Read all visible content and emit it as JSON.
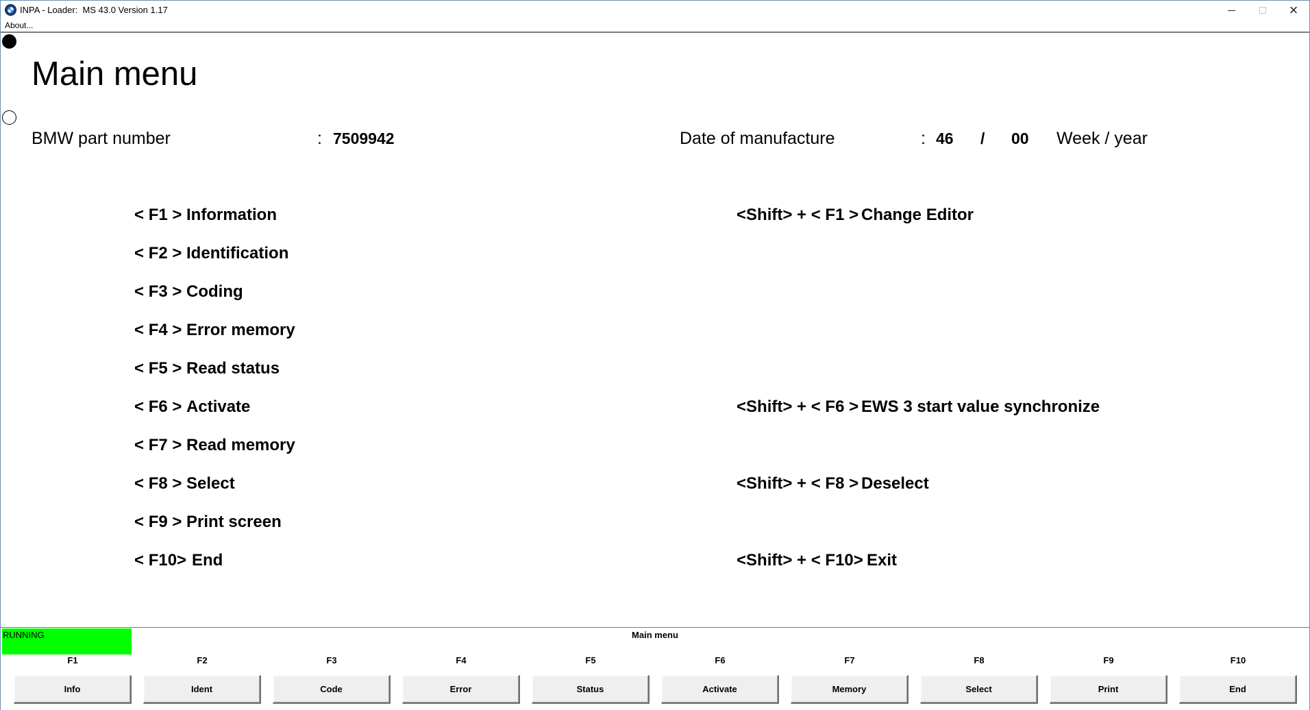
{
  "window": {
    "title": "INPA - Loader:  MS 43.0 Version 1.17",
    "icon": "bmw-logo-icon",
    "controls": {
      "minimize": "minimize-icon",
      "maximize": "maximize-icon",
      "close": "×"
    }
  },
  "menubar": {
    "about": "About..."
  },
  "main": {
    "title": "Main menu",
    "part_number_label": "BMW part number",
    "part_number_sep": ":",
    "part_number_value": "7509942",
    "date_label": "Date of manufacture",
    "date_sep": ":",
    "date_week": "46",
    "date_slash": "/",
    "date_year": "00",
    "date_unit": "Week / year"
  },
  "menu_left": [
    {
      "key": "< F1 >",
      "desc": "Information"
    },
    {
      "key": "< F2 >",
      "desc": "Identification"
    },
    {
      "key": "< F3 >",
      "desc": "Coding"
    },
    {
      "key": "< F4 >",
      "desc": "Error memory"
    },
    {
      "key": "< F5 >",
      "desc": "Read status"
    },
    {
      "key": "< F6 >",
      "desc": "Activate"
    },
    {
      "key": "< F7 >",
      "desc": "Read memory"
    },
    {
      "key": "< F8 >",
      "desc": "Select"
    },
    {
      "key": "< F9 >",
      "desc": "Print screen"
    },
    {
      "key": "< F10>",
      "desc": "End"
    }
  ],
  "menu_right": [
    {
      "key": "<Shift> + < F1 >",
      "desc": "Change Editor"
    },
    {
      "key": "<Shift> + < F6 >",
      "desc": "EWS 3 start value synchronize"
    },
    {
      "key": "<Shift> + < F8 >",
      "desc": "Deselect"
    },
    {
      "key": "<Shift> + < F10>",
      "desc": "Exit"
    }
  ],
  "status": {
    "text": "RUNNING",
    "color": "#00ff00"
  },
  "screen_name": "Main menu",
  "fkeys": [
    {
      "label": "F1",
      "button": "Info"
    },
    {
      "label": "F2",
      "button": "Ident"
    },
    {
      "label": "F3",
      "button": "Code"
    },
    {
      "label": "F4",
      "button": "Error"
    },
    {
      "label": "F5",
      "button": "Status"
    },
    {
      "label": "F6",
      "button": "Activate"
    },
    {
      "label": "F7",
      "button": "Memory"
    },
    {
      "label": "F8",
      "button": "Select"
    },
    {
      "label": "F9",
      "button": "Print"
    },
    {
      "label": "F10",
      "button": "End"
    }
  ]
}
